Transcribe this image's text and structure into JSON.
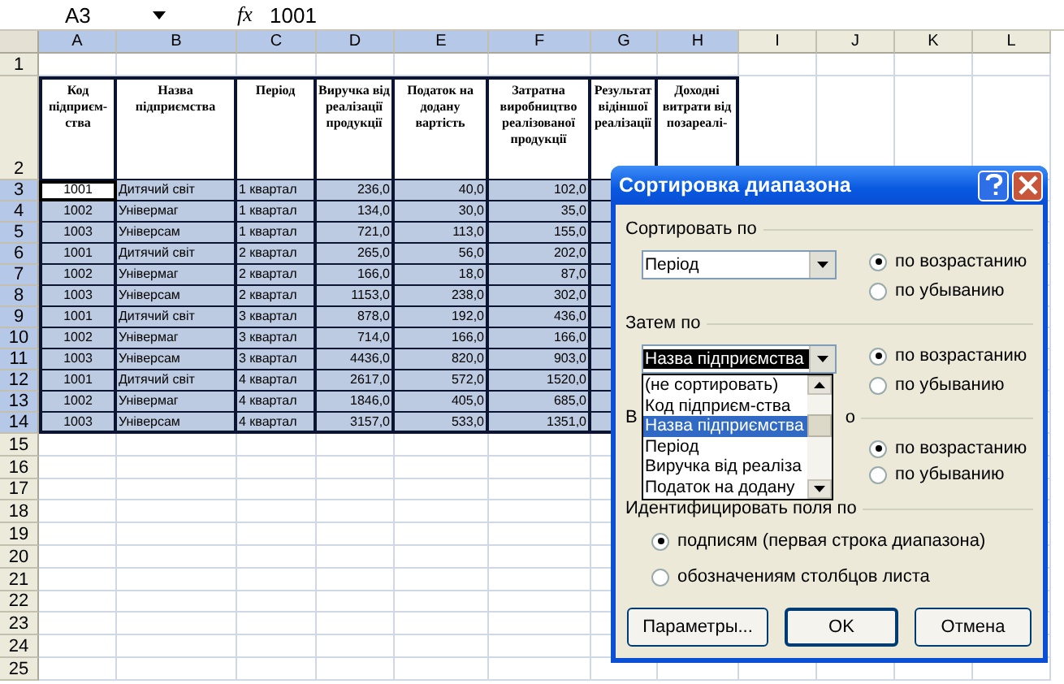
{
  "formula_bar": {
    "name_box": "A3",
    "fx": "fx",
    "value": "1001"
  },
  "columns": [
    {
      "label": "A",
      "selected": true
    },
    {
      "label": "B",
      "selected": true
    },
    {
      "label": "C",
      "selected": true
    },
    {
      "label": "D",
      "selected": true
    },
    {
      "label": "E",
      "selected": true
    },
    {
      "label": "F",
      "selected": true
    },
    {
      "label": "G",
      "selected": true
    },
    {
      "label": "H",
      "selected": true
    },
    {
      "label": "I",
      "selected": false
    },
    {
      "label": "J",
      "selected": false
    },
    {
      "label": "K",
      "selected": false
    },
    {
      "label": "L",
      "selected": false
    }
  ],
  "rows": [
    {
      "number": "1",
      "selected": false,
      "cells": []
    },
    {
      "number": "2",
      "selected": false,
      "cells": [
        {
          "text": "Код підприєм-ства"
        },
        {
          "text": "Назва підприємства"
        },
        {
          "text": "Період"
        },
        {
          "text": "Виручка від реалізації продукції"
        },
        {
          "text": "Податок на додану вартість"
        },
        {
          "text": "Затратна виробництво реалізованої продукції"
        },
        {
          "text": "Результат відіншої реалізації"
        },
        {
          "text": "Доходні витрати від позареалі-"
        }
      ]
    },
    {
      "number": "3",
      "selected": true,
      "cells": [
        {
          "text": "1001",
          "active": true
        },
        {
          "text": "Дитячий світ",
          "active": false
        },
        {
          "text": "1 квартал",
          "active": false
        },
        {
          "text": "236,0",
          "active": false
        },
        {
          "text": "40,0",
          "active": false
        },
        {
          "text": "102,0",
          "active": false
        }
      ]
    },
    {
      "number": "4",
      "selected": true,
      "cells": [
        {
          "text": "1002",
          "active": false
        },
        {
          "text": "Універмаг",
          "active": false
        },
        {
          "text": "1 квартал",
          "active": false
        },
        {
          "text": "134,0",
          "active": false
        },
        {
          "text": "30,0",
          "active": false
        },
        {
          "text": "35,0",
          "active": false
        }
      ]
    },
    {
      "number": "5",
      "selected": true,
      "cells": [
        {
          "text": "1003",
          "active": false
        },
        {
          "text": "Універсам",
          "active": false
        },
        {
          "text": "1 квартал",
          "active": false
        },
        {
          "text": "721,0",
          "active": false
        },
        {
          "text": "113,0",
          "active": false
        },
        {
          "text": "155,0",
          "active": false
        }
      ]
    },
    {
      "number": "6",
      "selected": true,
      "cells": [
        {
          "text": "1001",
          "active": false
        },
        {
          "text": "Дитячий світ",
          "active": false
        },
        {
          "text": "2 квартал",
          "active": false
        },
        {
          "text": "265,0",
          "active": false
        },
        {
          "text": "56,0",
          "active": false
        },
        {
          "text": "202,0",
          "active": false
        }
      ]
    },
    {
      "number": "7",
      "selected": true,
      "cells": [
        {
          "text": "1002",
          "active": false
        },
        {
          "text": "Універмаг",
          "active": false
        },
        {
          "text": "2 квартал",
          "active": false
        },
        {
          "text": "166,0",
          "active": false
        },
        {
          "text": "18,0",
          "active": false
        },
        {
          "text": "87,0",
          "active": false
        }
      ]
    },
    {
      "number": "8",
      "selected": true,
      "cells": [
        {
          "text": "1003",
          "active": false
        },
        {
          "text": "Універсам",
          "active": false
        },
        {
          "text": "2 квартал",
          "active": false
        },
        {
          "text": "1153,0",
          "active": false
        },
        {
          "text": "238,0",
          "active": false
        },
        {
          "text": "302,0",
          "active": false
        }
      ]
    },
    {
      "number": "9",
      "selected": true,
      "cells": [
        {
          "text": "1001",
          "active": false
        },
        {
          "text": "Дитячий світ",
          "active": false
        },
        {
          "text": "3 квартал",
          "active": false
        },
        {
          "text": "878,0",
          "active": false
        },
        {
          "text": "192,0",
          "active": false
        },
        {
          "text": "436,0",
          "active": false
        }
      ]
    },
    {
      "number": "10",
      "selected": true,
      "cells": [
        {
          "text": "1002",
          "active": false
        },
        {
          "text": "Універмаг",
          "active": false
        },
        {
          "text": "3 квартал",
          "active": false
        },
        {
          "text": "714,0",
          "active": false
        },
        {
          "text": "166,0",
          "active": false
        },
        {
          "text": "166,0",
          "active": false
        }
      ]
    },
    {
      "number": "11",
      "selected": true,
      "cells": [
        {
          "text": "1003",
          "active": false
        },
        {
          "text": "Універсам",
          "active": false
        },
        {
          "text": "3 квартал",
          "active": false
        },
        {
          "text": "4436,0",
          "active": false
        },
        {
          "text": "820,0",
          "active": false
        },
        {
          "text": "903,0",
          "active": false
        }
      ]
    },
    {
      "number": "12",
      "selected": true,
      "cells": [
        {
          "text": "1001",
          "active": false
        },
        {
          "text": "Дитячий світ",
          "active": false
        },
        {
          "text": "4 квартал",
          "active": false
        },
        {
          "text": "2617,0",
          "active": false
        },
        {
          "text": "572,0",
          "active": false
        },
        {
          "text": "1520,0",
          "active": false
        }
      ]
    },
    {
      "number": "13",
      "selected": true,
      "cells": [
        {
          "text": "1002",
          "active": false
        },
        {
          "text": "Універмаг",
          "active": false
        },
        {
          "text": "4 квартал",
          "active": false
        },
        {
          "text": "1846,0",
          "active": false
        },
        {
          "text": "405,0",
          "active": false
        },
        {
          "text": "685,0",
          "active": false
        }
      ]
    },
    {
      "number": "14",
      "selected": true,
      "cells": [
        {
          "text": "1003",
          "active": false
        },
        {
          "text": "Універсам",
          "active": false
        },
        {
          "text": "4 квартал",
          "active": false
        },
        {
          "text": "3157,0",
          "active": false
        },
        {
          "text": "533,0",
          "active": false
        },
        {
          "text": "1351,0",
          "active": false
        }
      ]
    },
    {
      "number": "15",
      "selected": false,
      "cells": []
    },
    {
      "number": "16",
      "selected": false,
      "cells": []
    },
    {
      "number": "17",
      "selected": false,
      "cells": []
    },
    {
      "number": "18",
      "selected": false,
      "cells": []
    },
    {
      "number": "19",
      "selected": false,
      "cells": []
    },
    {
      "number": "20",
      "selected": false,
      "cells": []
    },
    {
      "number": "21",
      "selected": false,
      "cells": []
    },
    {
      "number": "22",
      "selected": false,
      "cells": []
    },
    {
      "number": "23",
      "selected": false,
      "cells": []
    },
    {
      "number": "24",
      "selected": false,
      "cells": []
    },
    {
      "number": "25",
      "selected": false,
      "cells": []
    }
  ],
  "dialog": {
    "title": "Сортировка диапазона",
    "sort_by": {
      "label": "Сортировать по",
      "value": "Період",
      "options": [
        {
          "label": "по возрастанию",
          "selected": true
        },
        {
          "label": "по убыванию",
          "selected": false
        }
      ]
    },
    "then_by": {
      "label": "Затем по",
      "value": "Назва підприємства",
      "options": [
        {
          "label": "по возрастанию",
          "selected": true
        },
        {
          "label": "по убыванию",
          "selected": false
        }
      ],
      "list": [
        {
          "label": "(не сортировать)",
          "selected": false
        },
        {
          "label": "Код підприєм-ства",
          "selected": false
        },
        {
          "label": "Назва підприємства",
          "selected": true
        },
        {
          "label": "Період",
          "selected": false
        },
        {
          "label": "Виручка від реаліза",
          "selected": false
        },
        {
          "label": "Податок на додану",
          "selected": false
        }
      ]
    },
    "then_by_2": {
      "label_start": "В",
      "label_end": "о",
      "options": [
        {
          "label": "по возрастанию",
          "selected": true
        },
        {
          "label": "по убыванию",
          "selected": false
        }
      ]
    },
    "identify": {
      "label": "Идентифицировать поля по",
      "options": [
        {
          "label": "подписям (первая строка диапазона)",
          "selected": true
        },
        {
          "label": "обозначениям столбцов листа",
          "selected": false
        }
      ]
    },
    "buttons": [
      "Параметры...",
      "OK",
      "Отмена"
    ]
  }
}
